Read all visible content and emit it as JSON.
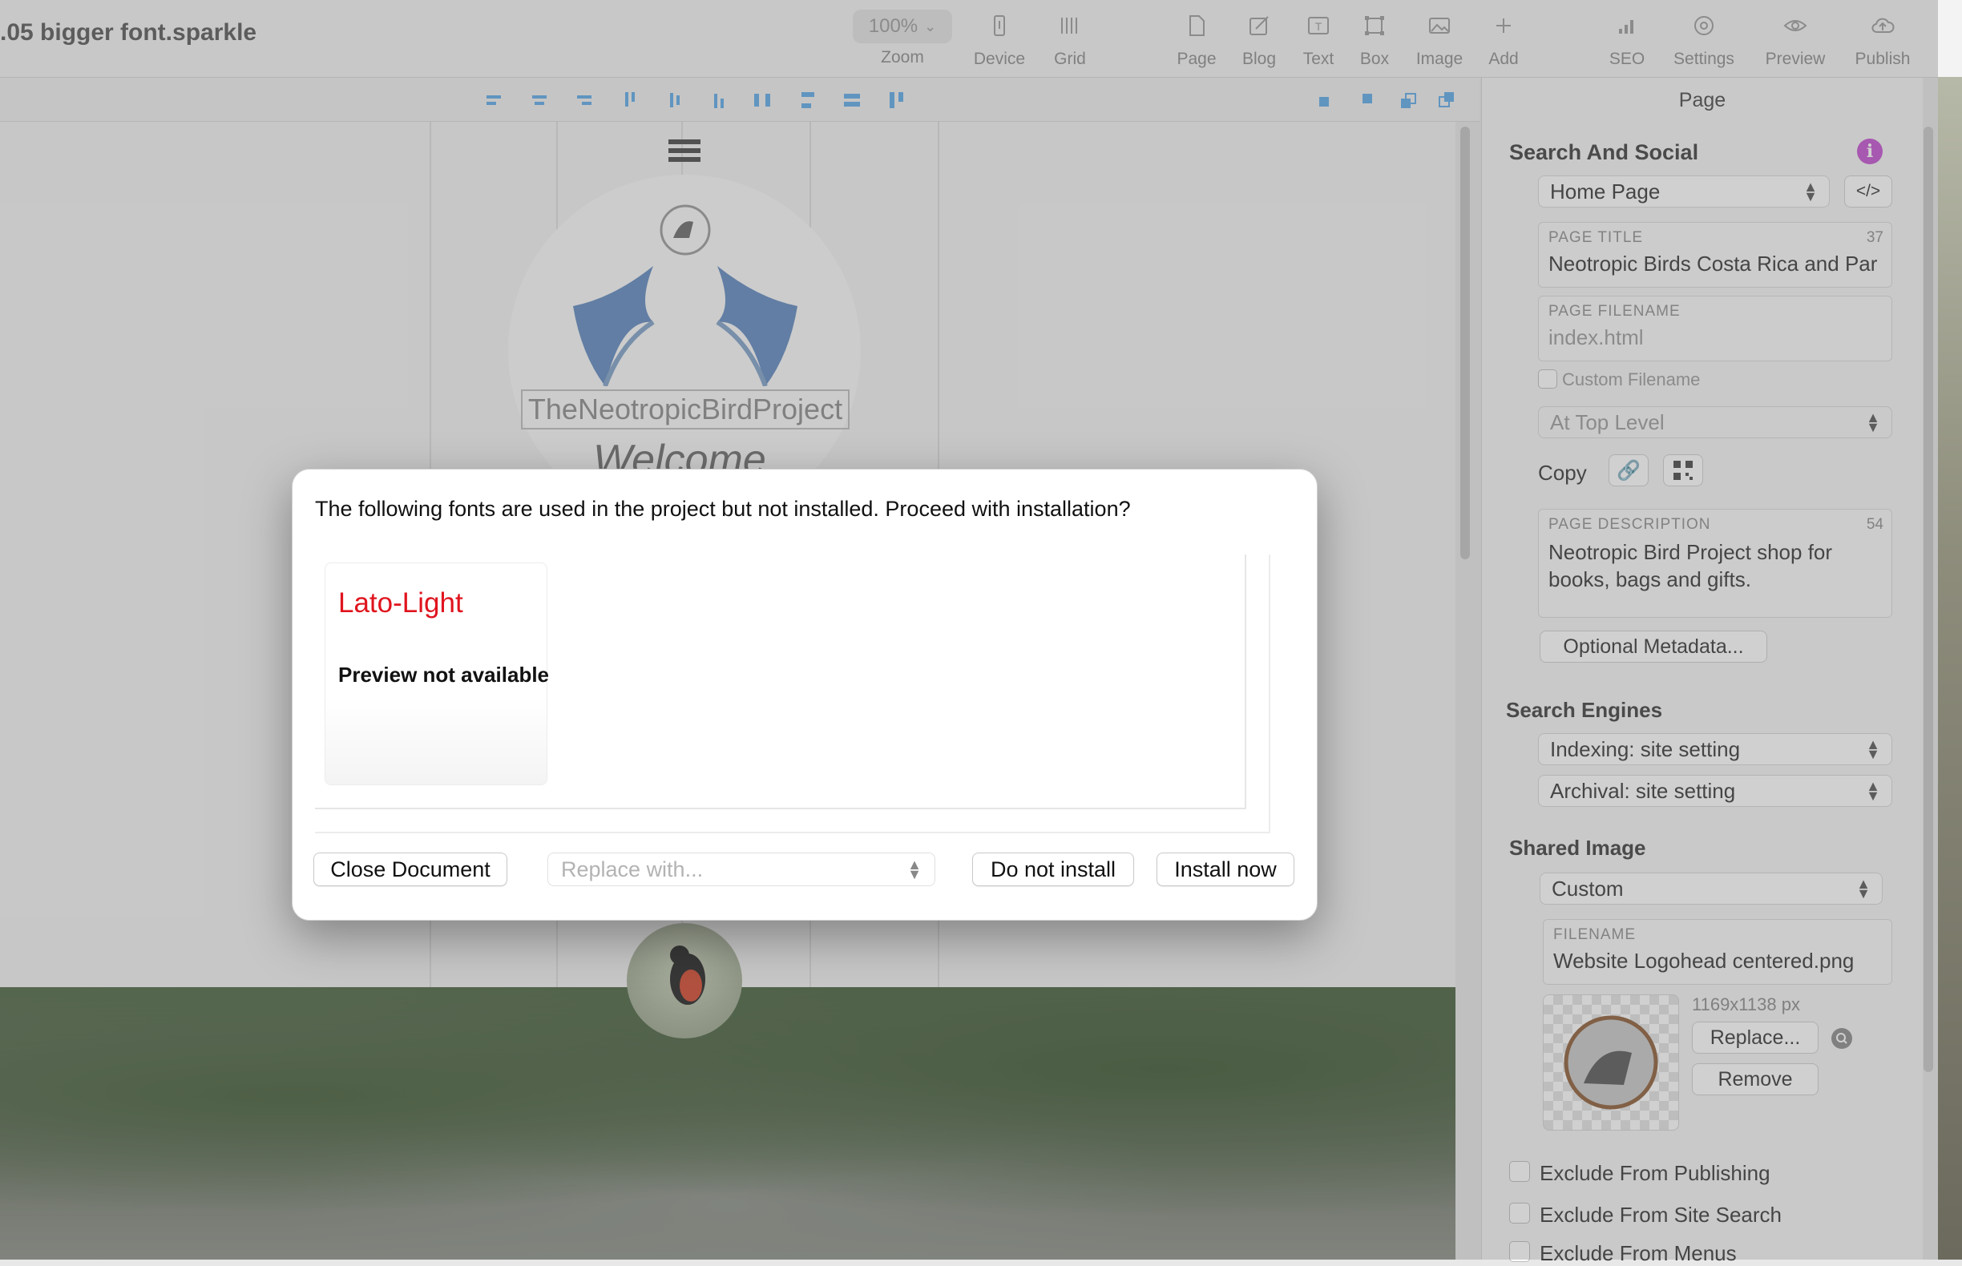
{
  "window": {
    "title": ".05 bigger font.sparkle"
  },
  "toolbar": {
    "zoom_value": "100%",
    "items": [
      {
        "label": "Zoom",
        "icon": "zoom-popup"
      },
      {
        "label": "Device",
        "icon": "device-icon"
      },
      {
        "label": "Grid",
        "icon": "grid-icon"
      },
      {
        "label": "Page",
        "icon": "page-icon"
      },
      {
        "label": "Blog",
        "icon": "blog-icon"
      },
      {
        "label": "Text",
        "icon": "text-icon"
      },
      {
        "label": "Box",
        "icon": "box-icon"
      },
      {
        "label": "Image",
        "icon": "image-icon"
      },
      {
        "label": "Add",
        "icon": "add-icon"
      },
      {
        "label": "SEO",
        "icon": "seo-icon"
      },
      {
        "label": "Settings",
        "icon": "settings-icon"
      },
      {
        "label": "Preview",
        "icon": "eye-icon"
      },
      {
        "label": "Publish",
        "icon": "cloud-upload-icon"
      }
    ]
  },
  "canvas": {
    "logo_text": "TheNeotropicBirdProject",
    "welcome_text": "Welcome"
  },
  "panel": {
    "header": "Page",
    "search_social": {
      "title": "Search And Social",
      "page_select": "Home Page",
      "code_button": "</>",
      "page_title_caption": "PAGE TITLE",
      "page_title_count": "37",
      "page_title_value": "Neotropic Birds Costa Rica and Par",
      "filename_caption": "PAGE FILENAME",
      "filename_value": "index.html",
      "custom_filename_label": "Custom Filename",
      "level_select": "At Top Level",
      "copy_label": "Copy",
      "description_caption": "PAGE DESCRIPTION",
      "description_count": "54",
      "description_line1": "Neotropic Bird Project shop for",
      "description_line2": "books, bags and gifts.",
      "optional_metadata_button": "Optional Metadata..."
    },
    "search_engines": {
      "title": "Search Engines",
      "indexing": "Indexing: site setting",
      "archival": "Archival: site setting"
    },
    "shared_image": {
      "title": "Shared Image",
      "mode": "Custom",
      "filename_caption": "FILENAME",
      "filename_value": "Website Logohead centered.png",
      "dimensions": "1169x1138 px",
      "replace_button": "Replace...",
      "remove_button": "Remove"
    },
    "checkboxes": [
      {
        "label": "Exclude From Publishing",
        "checked": false
      },
      {
        "label": "Exclude From Site Search",
        "checked": false
      },
      {
        "label": "Exclude From Menus",
        "checked": false
      }
    ]
  },
  "dialog": {
    "message": "The following fonts are used in the project but not installed. Proceed with installation?",
    "font_name": "Lato-Light",
    "preview_text": "Preview not available",
    "close_button": "Close Document",
    "replace_placeholder": "Replace with...",
    "do_not_install_button": "Do not install",
    "install_button": "Install now"
  },
  "colors": {
    "missing_font": "#e0141e",
    "info_badge": "#c34fd0",
    "align_icon": "#5aa8e8"
  }
}
